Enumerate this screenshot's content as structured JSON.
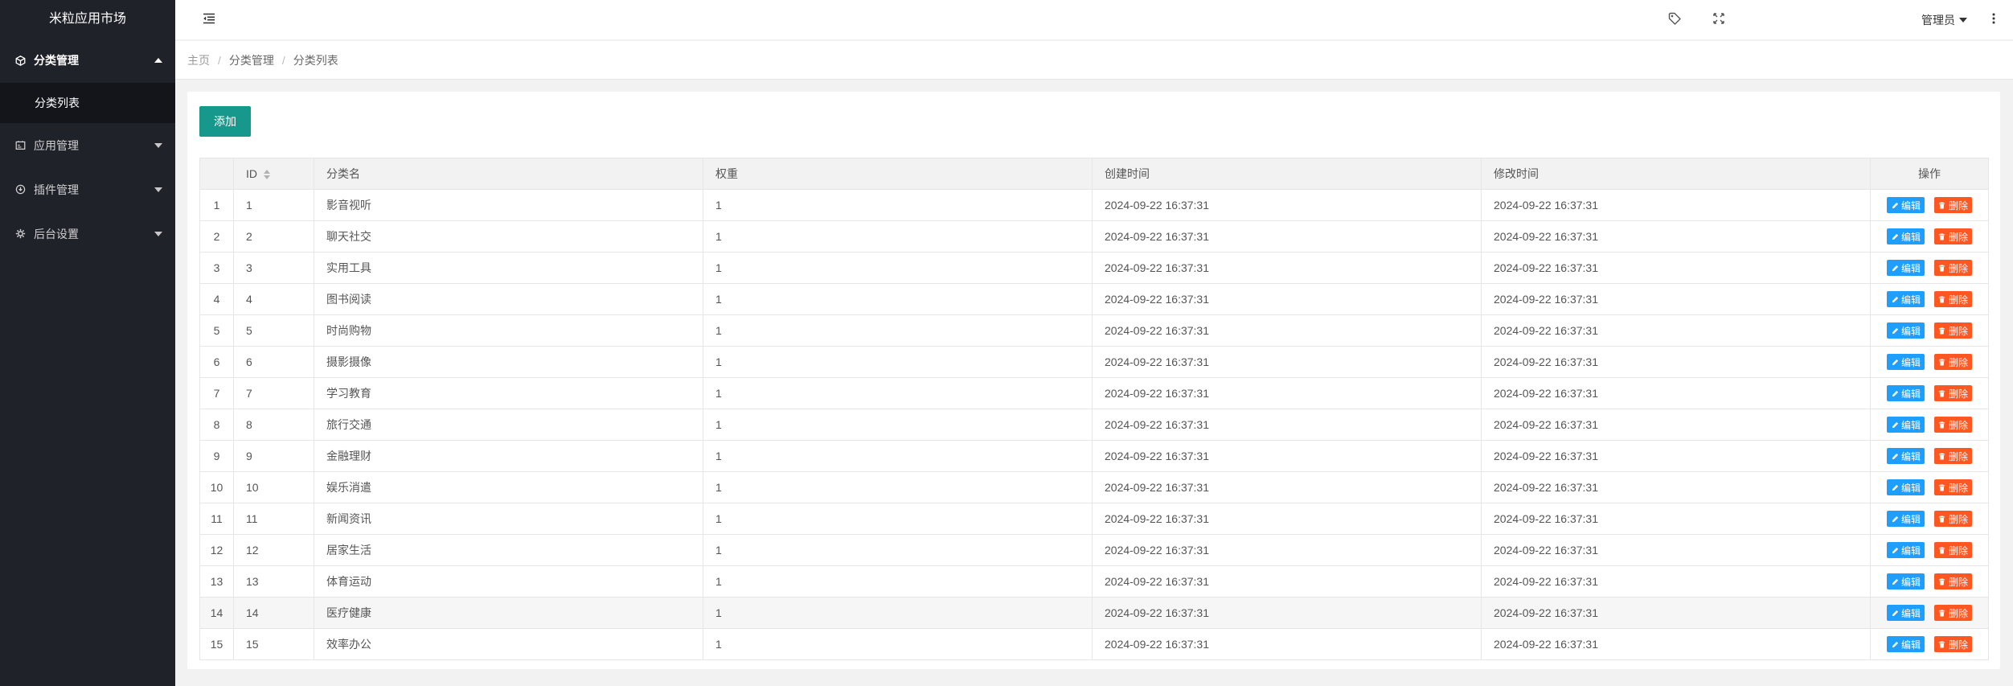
{
  "app": {
    "title": "米粒应用市场"
  },
  "sidebar": {
    "items": [
      {
        "label": "分类管理",
        "icon": "cube-icon",
        "open": true,
        "children": [
          {
            "label": "分类列表"
          }
        ]
      },
      {
        "label": "应用管理",
        "icon": "app-icon",
        "open": false
      },
      {
        "label": "插件管理",
        "icon": "plugin-icon",
        "open": false
      },
      {
        "label": "后台设置",
        "icon": "gear-icon",
        "open": false
      }
    ]
  },
  "header": {
    "user_label": "管理员",
    "icons": [
      "menu-toggle-icon",
      "tag-icon",
      "fullscreen-icon",
      "more-vertical-icon"
    ]
  },
  "breadcrumb": [
    "主页",
    "分类管理",
    "分类列表"
  ],
  "toolbar": {
    "add_label": "添加"
  },
  "table": {
    "columns": [
      "",
      "ID",
      "分类名",
      "权重",
      "创建时间",
      "修改时间",
      "操作"
    ],
    "edit_label": "编辑",
    "delete_label": "删除",
    "rows": [
      {
        "no": "1",
        "id": "1",
        "name": "影音视听",
        "weight": "1",
        "created": "2024-09-22 16:37:31",
        "updated": "2024-09-22 16:37:31"
      },
      {
        "no": "2",
        "id": "2",
        "name": "聊天社交",
        "weight": "1",
        "created": "2024-09-22 16:37:31",
        "updated": "2024-09-22 16:37:31"
      },
      {
        "no": "3",
        "id": "3",
        "name": "实用工具",
        "weight": "1",
        "created": "2024-09-22 16:37:31",
        "updated": "2024-09-22 16:37:31"
      },
      {
        "no": "4",
        "id": "4",
        "name": "图书阅读",
        "weight": "1",
        "created": "2024-09-22 16:37:31",
        "updated": "2024-09-22 16:37:31"
      },
      {
        "no": "5",
        "id": "5",
        "name": "时尚购物",
        "weight": "1",
        "created": "2024-09-22 16:37:31",
        "updated": "2024-09-22 16:37:31"
      },
      {
        "no": "6",
        "id": "6",
        "name": "摄影摄像",
        "weight": "1",
        "created": "2024-09-22 16:37:31",
        "updated": "2024-09-22 16:37:31"
      },
      {
        "no": "7",
        "id": "7",
        "name": "学习教育",
        "weight": "1",
        "created": "2024-09-22 16:37:31",
        "updated": "2024-09-22 16:37:31"
      },
      {
        "no": "8",
        "id": "8",
        "name": "旅行交通",
        "weight": "1",
        "created": "2024-09-22 16:37:31",
        "updated": "2024-09-22 16:37:31"
      },
      {
        "no": "9",
        "id": "9",
        "name": "金融理财",
        "weight": "1",
        "created": "2024-09-22 16:37:31",
        "updated": "2024-09-22 16:37:31"
      },
      {
        "no": "10",
        "id": "10",
        "name": "娱乐消遣",
        "weight": "1",
        "created": "2024-09-22 16:37:31",
        "updated": "2024-09-22 16:37:31"
      },
      {
        "no": "11",
        "id": "11",
        "name": "新闻资讯",
        "weight": "1",
        "created": "2024-09-22 16:37:31",
        "updated": "2024-09-22 16:37:31"
      },
      {
        "no": "12",
        "id": "12",
        "name": "居家生活",
        "weight": "1",
        "created": "2024-09-22 16:37:31",
        "updated": "2024-09-22 16:37:31"
      },
      {
        "no": "13",
        "id": "13",
        "name": "体育运动",
        "weight": "1",
        "created": "2024-09-22 16:37:31",
        "updated": "2024-09-22 16:37:31"
      },
      {
        "no": "14",
        "id": "14",
        "name": "医疗健康",
        "weight": "1",
        "created": "2024-09-22 16:37:31",
        "updated": "2024-09-22 16:37:31",
        "highlighted": true
      },
      {
        "no": "15",
        "id": "15",
        "name": "效率办公",
        "weight": "1",
        "created": "2024-09-22 16:37:31",
        "updated": "2024-09-22 16:37:31"
      }
    ]
  },
  "colors": {
    "sidebar_bg": "#20222a",
    "sidebar_sub_bg": "#13151a",
    "primary": "#16998c",
    "edit": "#1e9fff",
    "delete": "#ff5722"
  }
}
